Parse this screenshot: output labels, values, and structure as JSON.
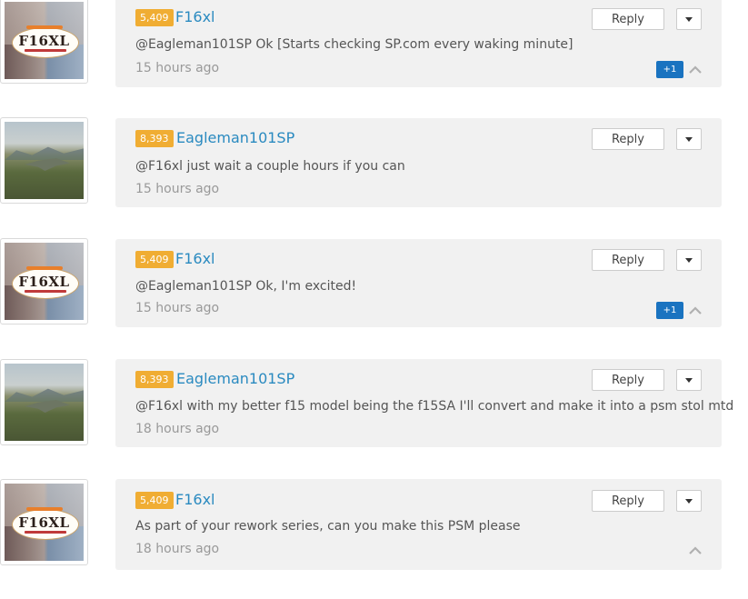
{
  "comments": [
    {
      "reputation": "5,409",
      "author": "F16xl",
      "avatar": "f16xl-logo-avatar",
      "text": "@Eagleman101SP Ok [Starts checking SP.com every waking minute]",
      "time": "15 hours ago",
      "reply_label": "Reply",
      "votes": "+1"
    },
    {
      "reputation": "8,393",
      "author": "Eagleman101SP",
      "avatar": "jet-photo-avatar",
      "text": "@F16xl just wait a couple hours if you can",
      "time": "15 hours ago",
      "reply_label": "Reply",
      "votes": ""
    },
    {
      "reputation": "5,409",
      "author": "F16xl",
      "avatar": "f16xl-logo-avatar",
      "text": "@Eagleman101SP Ok, I'm excited!",
      "time": "15 hours ago",
      "reply_label": "Reply",
      "votes": "+1"
    },
    {
      "reputation": "8,393",
      "author": "Eagleman101SP",
      "avatar": "jet-photo-avatar",
      "text": "@F16xl with my better f15 model being the f15SA I'll convert and make it into a psm stol mtd",
      "time": "18 hours ago",
      "reply_label": "Reply",
      "votes": ""
    },
    {
      "reputation": "5,409",
      "author": "F16xl",
      "avatar": "f16xl-logo-avatar",
      "text": "As part of your rework series, can you make this PSM please",
      "time": "18 hours ago",
      "reply_label": "Reply",
      "votes": ""
    }
  ],
  "avatar_logo_text": "F16XL",
  "colors": {
    "author": "#2a8ac0",
    "badge": "#f0ad33",
    "vote": "#1a73c0",
    "bubble": "#f1f1f1"
  }
}
